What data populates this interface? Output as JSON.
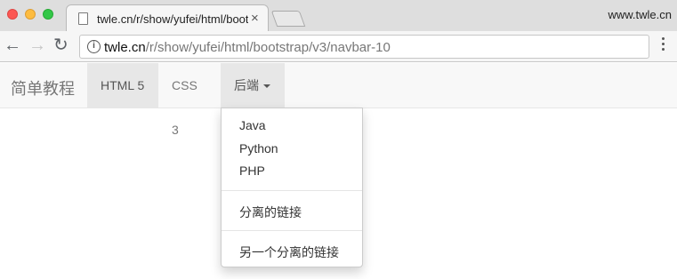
{
  "browser": {
    "tab_title": "twle.cn/r/show/yufei/html/boots",
    "tab_close": "×",
    "top_right_domain": "www.twle.cn",
    "url_host": "twle.cn",
    "url_path": "/r/show/yufei/html/bootstrap/v3/navbar-10",
    "back_glyph": "←",
    "forward_glyph": "→",
    "reload_glyph": "↻",
    "info_glyph": "i"
  },
  "navbar": {
    "brand": "简单教程",
    "items": [
      {
        "label": "HTML 5"
      },
      {
        "label": "CSS 3"
      },
      {
        "label": "后端"
      }
    ]
  },
  "dropdown": {
    "items": [
      "Java",
      "Python",
      "PHP",
      "分离的链接",
      "另一个分离的链接"
    ]
  }
}
